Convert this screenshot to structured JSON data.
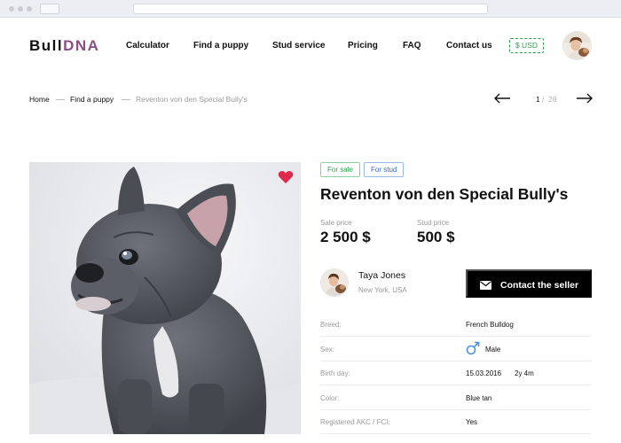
{
  "header": {
    "logo_part1": "Bull",
    "logo_part2": "DNA",
    "nav": [
      "Calculator",
      "Find a puppy",
      "Stud service",
      "Pricing",
      "FAQ",
      "Contact us"
    ],
    "currency": "$ USD"
  },
  "breadcrumb": {
    "home": "Home",
    "section": "Find a puppy",
    "current": "Reventon von den Special Bully's"
  },
  "pager": {
    "current": "1",
    "separator": "/",
    "total": "28"
  },
  "listing": {
    "tags": [
      "For sale",
      "For stud"
    ],
    "title": "Reventon von den Special Bully's",
    "sale_price_label": "Sale price",
    "sale_price": "2 500 $",
    "stud_price_label": "Stud price",
    "stud_price": "500 $",
    "favorite": true
  },
  "seller": {
    "name": "Taya Jones",
    "location": "New York, USA",
    "contact_label": "Contact the seller"
  },
  "details": [
    {
      "label": "Breed:",
      "value": "French Bulldog"
    },
    {
      "label": "Sex:",
      "value": "Male"
    },
    {
      "label": "Birth day:",
      "value": "15.03.2016",
      "age": "2y 4m"
    },
    {
      "label": "Color:",
      "value": "Blue tan"
    },
    {
      "label": "Registered AKC / FCI:",
      "value": "Yes"
    }
  ],
  "colors": {
    "brand_accent": "#8b4e86",
    "sale_tag": "#2e9e4e",
    "stud_tag": "#2f6cc8",
    "heart": "#e0294a",
    "male_icon": "#4a90e2",
    "button_bg": "#000000"
  },
  "icons": {
    "favorite": "heart-icon",
    "contact": "envelope-icon",
    "sex": "male-icon",
    "prev": "arrow-left-icon",
    "next": "arrow-right-icon"
  }
}
